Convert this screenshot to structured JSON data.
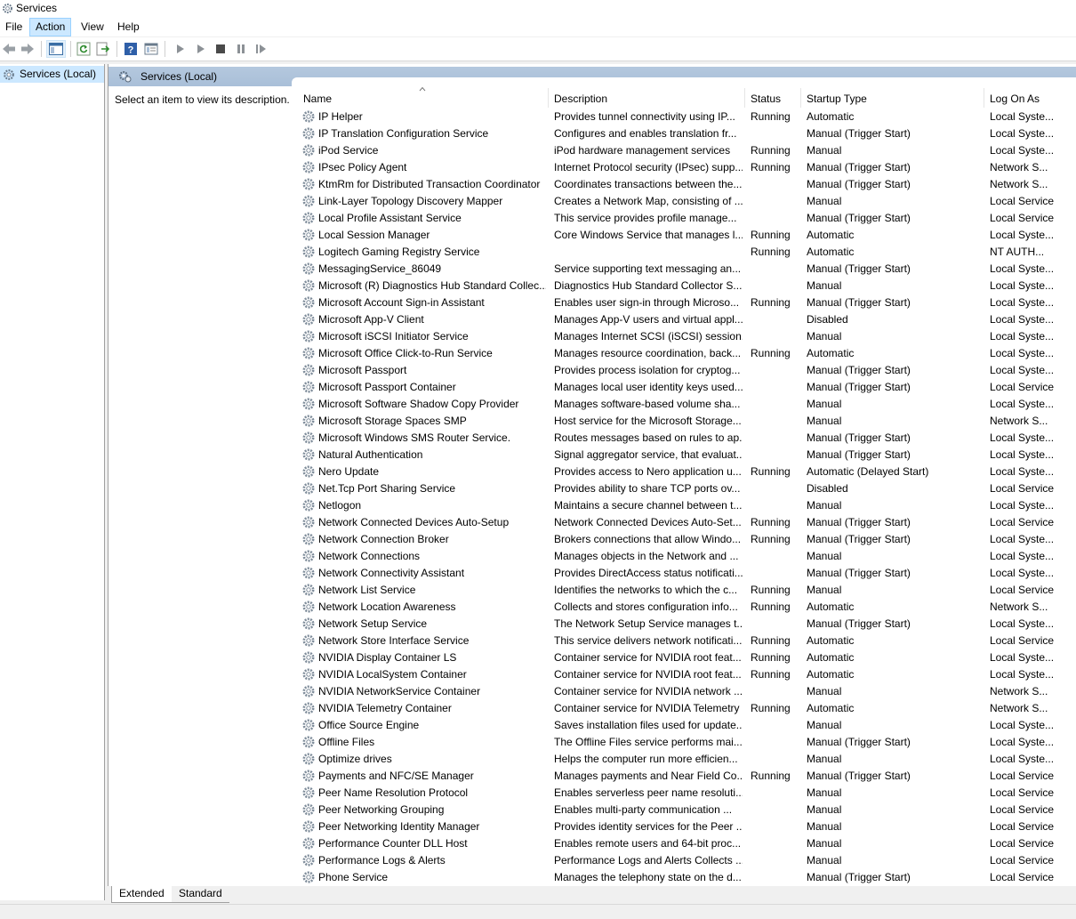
{
  "window": {
    "title": "Services"
  },
  "menu": {
    "items": [
      "File",
      "Action",
      "View",
      "Help"
    ],
    "active": "Action"
  },
  "tree": {
    "root_label": "Services (Local)"
  },
  "pane": {
    "header_label": "Services (Local)",
    "description_hint": "Select an item to view its description."
  },
  "columns": {
    "name": "Name",
    "description": "Description",
    "status": "Status",
    "startup": "Startup Type",
    "logon": "Log On As"
  },
  "tabs": {
    "extended": "Extended",
    "standard": "Standard"
  },
  "services": [
    {
      "name": "IP Helper",
      "desc": "Provides tunnel connectivity using IP...",
      "status": "Running",
      "startup": "Automatic",
      "logon": "Local Syste..."
    },
    {
      "name": "IP Translation Configuration Service",
      "desc": "Configures and enables translation fr...",
      "status": "",
      "startup": "Manual (Trigger Start)",
      "logon": "Local Syste..."
    },
    {
      "name": "iPod Service",
      "desc": "iPod hardware management services",
      "status": "Running",
      "startup": "Manual",
      "logon": "Local Syste..."
    },
    {
      "name": "IPsec Policy Agent",
      "desc": "Internet Protocol security (IPsec) supp...",
      "status": "Running",
      "startup": "Manual (Trigger Start)",
      "logon": "Network S..."
    },
    {
      "name": "KtmRm for Distributed Transaction Coordinator",
      "desc": "Coordinates transactions between the...",
      "status": "",
      "startup": "Manual (Trigger Start)",
      "logon": "Network S..."
    },
    {
      "name": "Link-Layer Topology Discovery Mapper",
      "desc": "Creates a Network Map, consisting of ...",
      "status": "",
      "startup": "Manual",
      "logon": "Local Service"
    },
    {
      "name": "Local Profile Assistant Service",
      "desc": "This service provides profile manage...",
      "status": "",
      "startup": "Manual (Trigger Start)",
      "logon": "Local Service"
    },
    {
      "name": "Local Session Manager",
      "desc": "Core Windows Service that manages l...",
      "status": "Running",
      "startup": "Automatic",
      "logon": "Local Syste..."
    },
    {
      "name": "Logitech Gaming Registry Service",
      "desc": "",
      "status": "Running",
      "startup": "Automatic",
      "logon": "NT AUTH..."
    },
    {
      "name": "MessagingService_86049",
      "desc": "Service supporting text messaging an...",
      "status": "",
      "startup": "Manual (Trigger Start)",
      "logon": "Local Syste..."
    },
    {
      "name": "Microsoft (R) Diagnostics Hub Standard Collec...",
      "desc": "Diagnostics Hub Standard Collector S...",
      "status": "",
      "startup": "Manual",
      "logon": "Local Syste..."
    },
    {
      "name": "Microsoft Account Sign-in Assistant",
      "desc": "Enables user sign-in through Microso...",
      "status": "Running",
      "startup": "Manual (Trigger Start)",
      "logon": "Local Syste..."
    },
    {
      "name": "Microsoft App-V Client",
      "desc": "Manages App-V users and virtual appl...",
      "status": "",
      "startup": "Disabled",
      "logon": "Local Syste..."
    },
    {
      "name": "Microsoft iSCSI Initiator Service",
      "desc": "Manages Internet SCSI (iSCSI) session...",
      "status": "",
      "startup": "Manual",
      "logon": "Local Syste..."
    },
    {
      "name": "Microsoft Office Click-to-Run Service",
      "desc": "Manages resource coordination, back...",
      "status": "Running",
      "startup": "Automatic",
      "logon": "Local Syste..."
    },
    {
      "name": "Microsoft Passport",
      "desc": "Provides process isolation for cryptog...",
      "status": "",
      "startup": "Manual (Trigger Start)",
      "logon": "Local Syste..."
    },
    {
      "name": "Microsoft Passport Container",
      "desc": "Manages local user identity keys used...",
      "status": "",
      "startup": "Manual (Trigger Start)",
      "logon": "Local Service"
    },
    {
      "name": "Microsoft Software Shadow Copy Provider",
      "desc": "Manages software-based volume sha...",
      "status": "",
      "startup": "Manual",
      "logon": "Local Syste..."
    },
    {
      "name": "Microsoft Storage Spaces SMP",
      "desc": "Host service for the Microsoft Storage...",
      "status": "",
      "startup": "Manual",
      "logon": "Network S..."
    },
    {
      "name": "Microsoft Windows SMS Router Service.",
      "desc": "Routes messages based on rules to ap...",
      "status": "",
      "startup": "Manual (Trigger Start)",
      "logon": "Local Syste..."
    },
    {
      "name": "Natural Authentication",
      "desc": "Signal aggregator service, that evaluat...",
      "status": "",
      "startup": "Manual (Trigger Start)",
      "logon": "Local Syste..."
    },
    {
      "name": "Nero Update",
      "desc": "Provides access to Nero application u...",
      "status": "Running",
      "startup": "Automatic (Delayed Start)",
      "logon": "Local Syste..."
    },
    {
      "name": "Net.Tcp Port Sharing Service",
      "desc": "Provides ability to share TCP ports ov...",
      "status": "",
      "startup": "Disabled",
      "logon": "Local Service"
    },
    {
      "name": "Netlogon",
      "desc": "Maintains a secure channel between t...",
      "status": "",
      "startup": "Manual",
      "logon": "Local Syste..."
    },
    {
      "name": "Network Connected Devices Auto-Setup",
      "desc": "Network Connected Devices Auto-Set...",
      "status": "Running",
      "startup": "Manual (Trigger Start)",
      "logon": "Local Service"
    },
    {
      "name": "Network Connection Broker",
      "desc": "Brokers connections that allow Windo...",
      "status": "Running",
      "startup": "Manual (Trigger Start)",
      "logon": "Local Syste..."
    },
    {
      "name": "Network Connections",
      "desc": "Manages objects in the Network and ...",
      "status": "",
      "startup": "Manual",
      "logon": "Local Syste..."
    },
    {
      "name": "Network Connectivity Assistant",
      "desc": "Provides DirectAccess status notificati...",
      "status": "",
      "startup": "Manual (Trigger Start)",
      "logon": "Local Syste..."
    },
    {
      "name": "Network List Service",
      "desc": "Identifies the networks to which the c...",
      "status": "Running",
      "startup": "Manual",
      "logon": "Local Service"
    },
    {
      "name": "Network Location Awareness",
      "desc": "Collects and stores configuration info...",
      "status": "Running",
      "startup": "Automatic",
      "logon": "Network S..."
    },
    {
      "name": "Network Setup Service",
      "desc": "The Network Setup Service manages t...",
      "status": "",
      "startup": "Manual (Trigger Start)",
      "logon": "Local Syste..."
    },
    {
      "name": "Network Store Interface Service",
      "desc": "This service delivers network notificati...",
      "status": "Running",
      "startup": "Automatic",
      "logon": "Local Service"
    },
    {
      "name": "NVIDIA Display Container LS",
      "desc": "Container service for NVIDIA root feat...",
      "status": "Running",
      "startup": "Automatic",
      "logon": "Local Syste..."
    },
    {
      "name": "NVIDIA LocalSystem Container",
      "desc": "Container service for NVIDIA root feat...",
      "status": "Running",
      "startup": "Automatic",
      "logon": "Local Syste..."
    },
    {
      "name": "NVIDIA NetworkService Container",
      "desc": "Container service for NVIDIA network ...",
      "status": "",
      "startup": "Manual",
      "logon": "Network S..."
    },
    {
      "name": "NVIDIA Telemetry Container",
      "desc": "Container service for NVIDIA Telemetry",
      "status": "Running",
      "startup": "Automatic",
      "logon": "Network S..."
    },
    {
      "name": "Office  Source Engine",
      "desc": "Saves installation files used for update...",
      "status": "",
      "startup": "Manual",
      "logon": "Local Syste..."
    },
    {
      "name": "Offline Files",
      "desc": "The Offline Files service performs mai...",
      "status": "",
      "startup": "Manual (Trigger Start)",
      "logon": "Local Syste..."
    },
    {
      "name": "Optimize drives",
      "desc": "Helps the computer run more efficien...",
      "status": "",
      "startup": "Manual",
      "logon": "Local Syste..."
    },
    {
      "name": "Payments and NFC/SE Manager",
      "desc": "Manages payments and Near Field Co...",
      "status": "Running",
      "startup": "Manual (Trigger Start)",
      "logon": "Local Service"
    },
    {
      "name": "Peer Name Resolution Protocol",
      "desc": "Enables serverless peer name resoluti...",
      "status": "",
      "startup": "Manual",
      "logon": "Local Service"
    },
    {
      "name": "Peer Networking Grouping",
      "desc": "Enables multi-party communication ...",
      "status": "",
      "startup": "Manual",
      "logon": "Local Service"
    },
    {
      "name": "Peer Networking Identity Manager",
      "desc": "Provides identity services for the Peer ...",
      "status": "",
      "startup": "Manual",
      "logon": "Local Service"
    },
    {
      "name": "Performance Counter DLL Host",
      "desc": "Enables remote users and 64-bit proc...",
      "status": "",
      "startup": "Manual",
      "logon": "Local Service"
    },
    {
      "name": "Performance Logs & Alerts",
      "desc": "Performance Logs and Alerts Collects ...",
      "status": "",
      "startup": "Manual",
      "logon": "Local Service"
    },
    {
      "name": "Phone Service",
      "desc": "Manages the telephony state on the d...",
      "status": "",
      "startup": "Manual (Trigger Start)",
      "logon": "Local Service"
    }
  ]
}
